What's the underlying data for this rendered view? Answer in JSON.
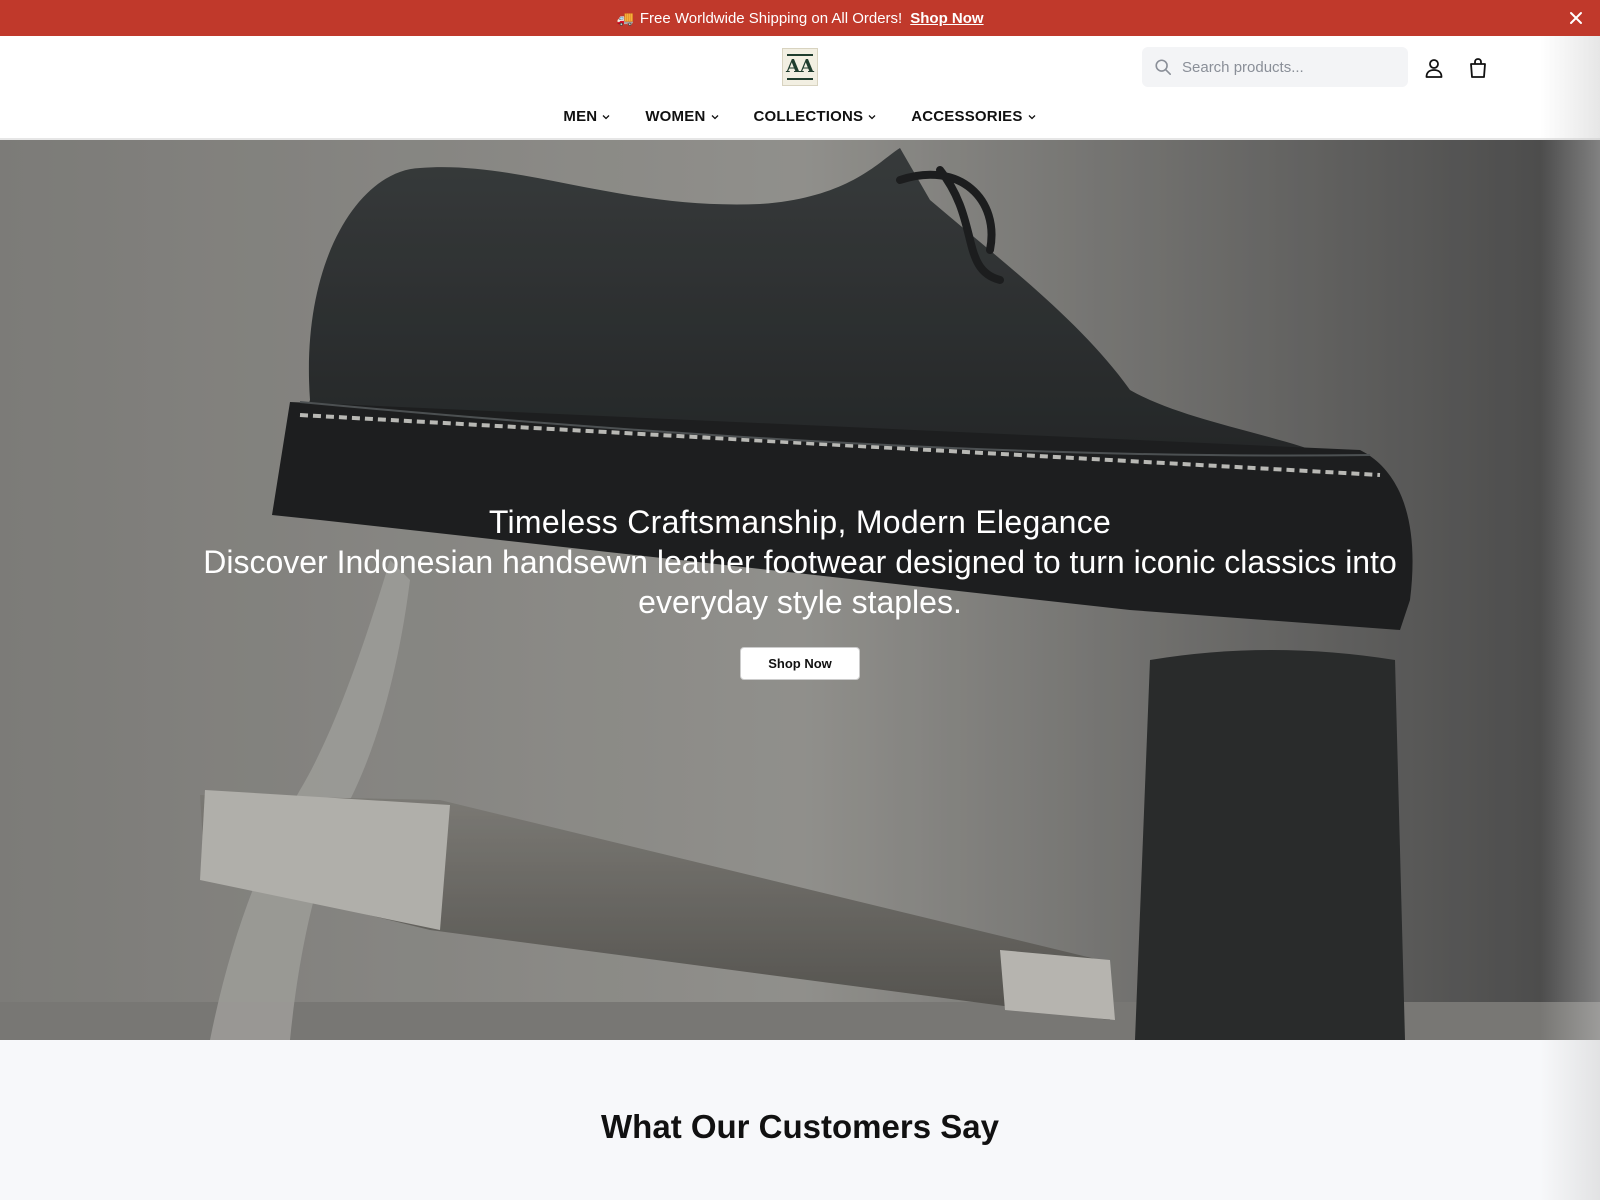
{
  "announcement": {
    "emoji": "🚚",
    "text": "Free Worldwide Shipping on All Orders!",
    "link_label": "Shop Now"
  },
  "header": {
    "logo_mark": "AA",
    "search_placeholder": "Search products..."
  },
  "nav": {
    "items": [
      {
        "label": "MEN"
      },
      {
        "label": "WOMEN"
      },
      {
        "label": "COLLECTIONS"
      },
      {
        "label": "ACCESSORIES"
      }
    ]
  },
  "hero": {
    "title": "Timeless Craftsmanship, Modern Elegance",
    "subtitle": "Discover Indonesian handsewn leather footwear designed to turn iconic classics into everyday style staples.",
    "cta_label": "Shop Now"
  },
  "testimonials": {
    "heading": "What Our Customers Say"
  },
  "colors": {
    "announcement_bg": "#c0392b",
    "hero_overlay": "#3a3a3a"
  },
  "icons": {
    "close": "close-icon",
    "search": "search-icon",
    "account": "user-icon",
    "cart": "shopping-bag-icon",
    "dropdown": "chevron-down-icon"
  }
}
